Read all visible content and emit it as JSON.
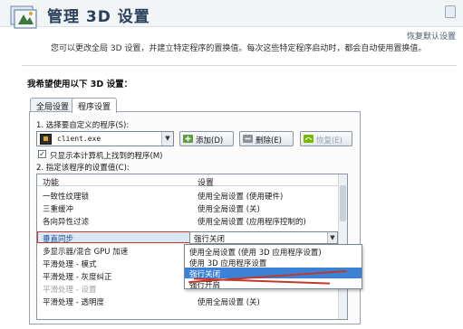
{
  "window": {
    "title": "管理 3D 设置",
    "restore_link": "恢复默认设置",
    "description": "您可以更改全局 3D 设置，并建立特定程序的置换值。每次这些特定程序启动时，都会自动使用置换值。"
  },
  "section_title": "我希望使用以下 3D 设置：",
  "tabs": [
    {
      "label": "全局设置",
      "active": false
    },
    {
      "label": "程序设置",
      "active": true
    }
  ],
  "program_settings": {
    "step1_label": "1. 选择要自定义的程序(S):",
    "selected_program": "client.exe",
    "buttons": {
      "add": "添加(D)",
      "remove": "删除(E)",
      "restore": "恢复(E)"
    },
    "checkbox_label": "只显示本计算机上找到的程序(M)",
    "checkbox_checked": true,
    "step2_label": "2. 指定该程序的设置值(C):"
  },
  "settings_table": {
    "columns": [
      "功能",
      "设置"
    ],
    "rows": [
      {
        "feature": "一致性纹理锁",
        "setting": "使用全局设置 (使用硬件)",
        "selected": false
      },
      {
        "feature": "三重缓冲",
        "setting": "使用全局设置 (关)",
        "selected": false
      },
      {
        "feature": "各向异性过滤",
        "setting": "使用全局设置 (应用程序控制的)",
        "selected": false
      },
      {
        "feature": "垂直同步",
        "setting": "强行关闭",
        "selected": true
      },
      {
        "feature": "多显示器/混合 GPU 加速",
        "setting": "",
        "selected": false
      },
      {
        "feature": "平滑处理 - 模式",
        "setting": "",
        "selected": false
      },
      {
        "feature": "平滑处理 - 灰度纠正",
        "setting": "",
        "selected": false
      },
      {
        "feature": "平滑处理 - 设置",
        "setting": "",
        "selected": false,
        "disabled": true
      },
      {
        "feature": "平滑处理 - 透明度",
        "setting": "使用全局设置 (关)",
        "selected": false
      }
    ]
  },
  "dropdown": {
    "current_value": "强行关闭",
    "options": [
      {
        "label": "使用全局设置 (使用 3D 应用程序设置)",
        "highlighted": false
      },
      {
        "label": "使用 3D 应用程序设置",
        "highlighted": false
      },
      {
        "label": "强行关闭",
        "highlighted": true
      },
      {
        "label": "强行开启",
        "highlighted": false
      }
    ]
  },
  "colors": {
    "highlight": "#3b82d6",
    "annotation": "#c0392b",
    "nvidia_green": "#76b900"
  }
}
